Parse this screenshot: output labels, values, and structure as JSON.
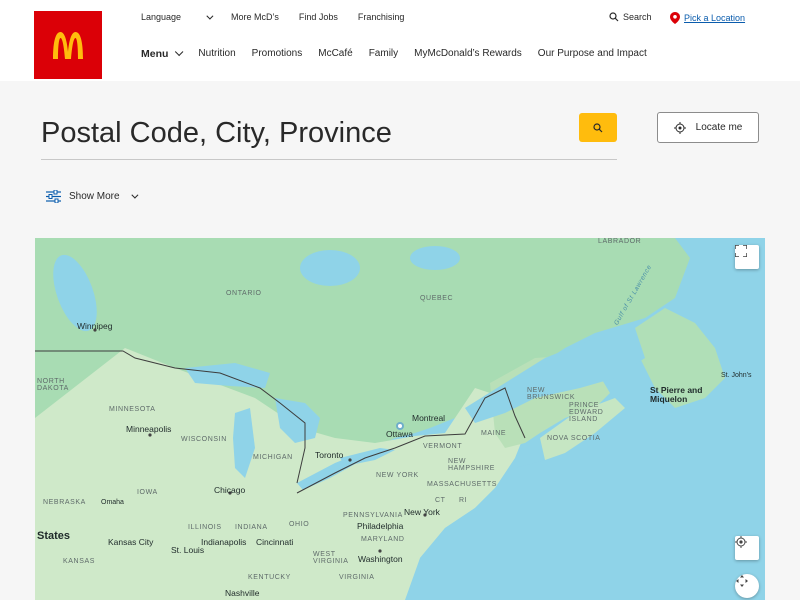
{
  "header": {
    "logo_alt": "McDonald's",
    "util_nav": [
      "Language",
      "More McD’s",
      "Find Jobs",
      "Franchising"
    ],
    "menu_label": "Menu",
    "main_nav": [
      "Nutrition",
      "Promotions",
      "McCafé",
      "Family",
      "MyMcDonald’s Rewards",
      "Our Purpose and Impact"
    ],
    "search_label": "Search",
    "pick_location_label": "Pick a Location"
  },
  "locator": {
    "placeholder": "Postal Code, City, Province",
    "locate_me_label": "Locate me",
    "show_more_label": "Show More"
  },
  "colors": {
    "brand_red": "#db0007",
    "brand_yellow": "#ffbc0d",
    "link_blue": "#0a5cad"
  },
  "map": {
    "labels": {
      "labrador": "LABRADOR",
      "ontario": "ONTARIO",
      "quebec": "QUEBEC",
      "winnipeg": "Winnipeg",
      "north_dakota": "NORTH\nDAKOTA",
      "minnesota": "MINNESOTA",
      "minneapolis": "Minneapolis",
      "wisconsin": "WISCONSIN",
      "michigan": "MICHIGAN",
      "iowa": "IOWA",
      "nebraska": "NEBRASKA",
      "omaha": "Omaha",
      "chicago": "Chicago",
      "illinois": "ILLINOIS",
      "indiana": "INDIANA",
      "ohio": "OHIO",
      "states": "States",
      "kansas": "KANSAS",
      "kansas_city": "Kansas City",
      "st_louis": "St. Louis",
      "indianapolis": "Indianapolis",
      "cincinnati": "Cincinnati",
      "west_virginia": "WEST\nVIRGINIA",
      "kentucky": "KENTUCKY",
      "virginia": "VIRGINIA",
      "nashville": "Nashville",
      "toronto": "Toronto",
      "ottawa": "Ottawa",
      "montreal": "Montreal",
      "new_york_state": "NEW YORK",
      "vermont": "VERMONT",
      "new_hampshire": "NEW\nHAMPSHIRE",
      "massachusetts": "MASSACHUSETTS",
      "ct": "CT",
      "ri": "RI",
      "new_york_city": "New York",
      "pennsylvania": "PENNSYLVANIA",
      "philadelphia": "Philadelphia",
      "maryland": "MARYLAND",
      "washington": "Washington",
      "maine": "MAINE",
      "new_brunswick": "NEW\nBRUNSWICK",
      "pei": "PRINCE\nEDWARD\nISLAND",
      "nova_scotia": "NOVA SCOTIA",
      "gulf": "Gulf of St Lawrence",
      "st_pierre": "St Pierre and\nMiquelon",
      "st_johns": "St. John's"
    }
  }
}
